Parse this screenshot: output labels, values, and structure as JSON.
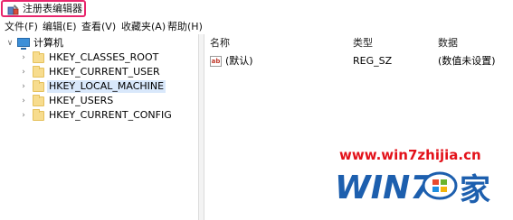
{
  "window": {
    "title": "注册表编辑器",
    "icon": "registry-editor-icon"
  },
  "menu": [
    "文件(F)",
    "编辑(E)",
    "查看(V)",
    "收藏夹(A)",
    "帮助(H)"
  ],
  "tree": {
    "root": {
      "label": "计算机",
      "icon": "computer-icon",
      "expanded": true
    },
    "children": [
      {
        "label": "HKEY_CLASSES_ROOT",
        "selected": false
      },
      {
        "label": "HKEY_CURRENT_USER",
        "selected": false
      },
      {
        "label": "HKEY_LOCAL_MACHINE",
        "selected": true
      },
      {
        "label": "HKEY_USERS",
        "selected": false
      },
      {
        "label": "HKEY_CURRENT_CONFIG",
        "selected": false
      }
    ]
  },
  "list": {
    "columns": [
      "名称",
      "类型",
      "数据"
    ],
    "rows": [
      {
        "name": "(默认)",
        "type": "REG_SZ",
        "data": "(数值未设置)",
        "icon": "string-value-icon"
      }
    ]
  },
  "watermark": {
    "url": "www.win7zhijia.cn",
    "logo_text": "WIN7之家",
    "logo_main": "WIN7.",
    "logo_char": "家"
  },
  "colors": {
    "title_highlight": "#e8266c",
    "selection": "#d9e8fb",
    "watermark_red": "#e3121a",
    "watermark_blue": "#1d5fae"
  }
}
